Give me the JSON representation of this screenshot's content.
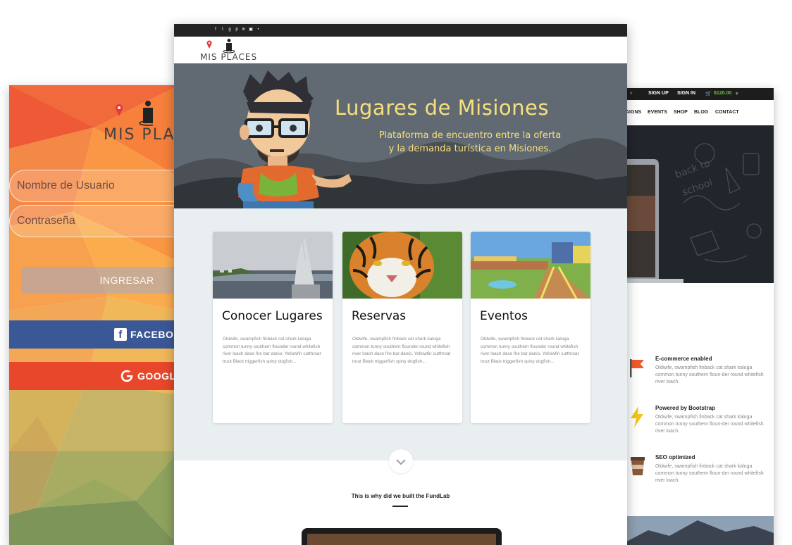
{
  "login": {
    "logo_text": "MIS PLACES",
    "username_placeholder": "Nombre de Usuario",
    "password_placeholder": "Contraseña",
    "login_button": "INGRESAR",
    "facebook_button": "FACEBOOK",
    "google_button": "GOOGLE"
  },
  "main": {
    "logo_text": "MIS PLACES",
    "social_icons": [
      "facebook-icon",
      "twitter-icon",
      "google-plus-icon",
      "pinterest-icon",
      "linkedin-icon",
      "instagram-icon",
      "rss-icon"
    ],
    "hero": {
      "title": "Lugares de Misiones",
      "subtitle_line1": "Plataforma de encuentro entre la oferta",
      "subtitle_line2": "y la demanda turística en Misiones."
    },
    "cards": [
      {
        "title": "Conocer Lugares",
        "text": "Oldwife, swampfish finback cat shark kaluga common tunny southern flounder round whitefish river loach dace fire bar danio. Yellowfin cutthroat trout Black triggerfish spiny dogfish..."
      },
      {
        "title": "Reservas",
        "text": "Oldwife, swampfish finback cat shark kaluga common tunny southern flounder round whitefish river loach dace fire bar danio. Yellowfin cutthroat trout Black triggerfish spiny dogfish..."
      },
      {
        "title": "Eventos",
        "text": "Oldwife, swampfish finback cat shark kaluga common tunny southern flounder round whitefish river loach dace fire bar danio. Yellowfin cutthroat trout Black triggerfish spiny dogfish..."
      }
    ],
    "why_text": "This is why did we built the FundLab"
  },
  "fund": {
    "topbar": {
      "sign_up": "SIGN UP",
      "sign_in": "SIGN IN",
      "cart_total": "$120.00"
    },
    "nav": [
      "AIGNS",
      "EVENTS",
      "SHOP",
      "BLOG",
      "CONTACT"
    ],
    "features": [
      {
        "title": "E-commerce enabled",
        "text": "Oldwife, swampfish finback cat shark kaluga common tunny southern floun-der round whitefish river loach."
      },
      {
        "title": "Powered by Bootstrap",
        "text": "Oldwife, swampfish finback cat shark kaluga common tunny southern floun-der round whitefish river loach."
      },
      {
        "title": "SEO optimized",
        "text": "Oldwife, swampfish finback cat shark kaluga common tunny southern floun-der round whitefish river loach."
      }
    ]
  },
  "colors": {
    "hero_title": "#f7e07c",
    "hero_bg": "#616a72",
    "facebook": "#3b5896",
    "google": "#e8472b",
    "cart_green": "#6cbf3a"
  }
}
